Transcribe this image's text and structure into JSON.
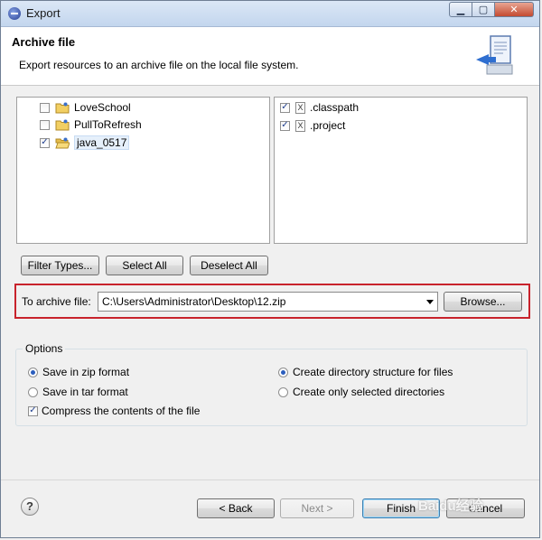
{
  "window": {
    "title": "Export",
    "controls": [
      "min",
      "max",
      "close"
    ]
  },
  "header": {
    "title": "Archive file",
    "description": "Export resources to an archive file on the local file system."
  },
  "projects": [
    {
      "label": "LoveSchool",
      "checked": false,
      "icon": "folder-icon"
    },
    {
      "label": "PullToRefresh",
      "checked": false,
      "icon": "folder-icon"
    },
    {
      "label": "java_0517",
      "checked": true,
      "icon": "folder-open-icon"
    }
  ],
  "files": [
    {
      "label": ".classpath",
      "checked": true,
      "icon": "xml-file-icon"
    },
    {
      "label": ".project",
      "checked": true,
      "icon": "xml-file-icon"
    }
  ],
  "selection_buttons": {
    "filter_types": "Filter Types...",
    "select_all": "Select All",
    "deselect_all": "Deselect All"
  },
  "archive": {
    "label": "To archive file:",
    "value": "C:\\Users\\Administrator\\Desktop\\12.zip",
    "browse": "Browse..."
  },
  "options": {
    "title": "Options",
    "zip": {
      "label": "Save in zip format",
      "selected": true
    },
    "tar": {
      "label": "Save in tar format",
      "selected": false
    },
    "compress": {
      "label": "Compress the contents of the file",
      "checked": true
    },
    "dir_structure": {
      "label": "Create directory structure for files",
      "selected": true
    },
    "selected_dirs": {
      "label": "Create only selected directories",
      "selected": false
    }
  },
  "footer": {
    "help": "?",
    "back": "< Back",
    "next": "Next >",
    "finish": "Finish",
    "cancel": "Cancel"
  },
  "watermark": "Baidu经验",
  "colors": {
    "highlight_box": "#c8232c",
    "accent": "#2b5ebd"
  }
}
